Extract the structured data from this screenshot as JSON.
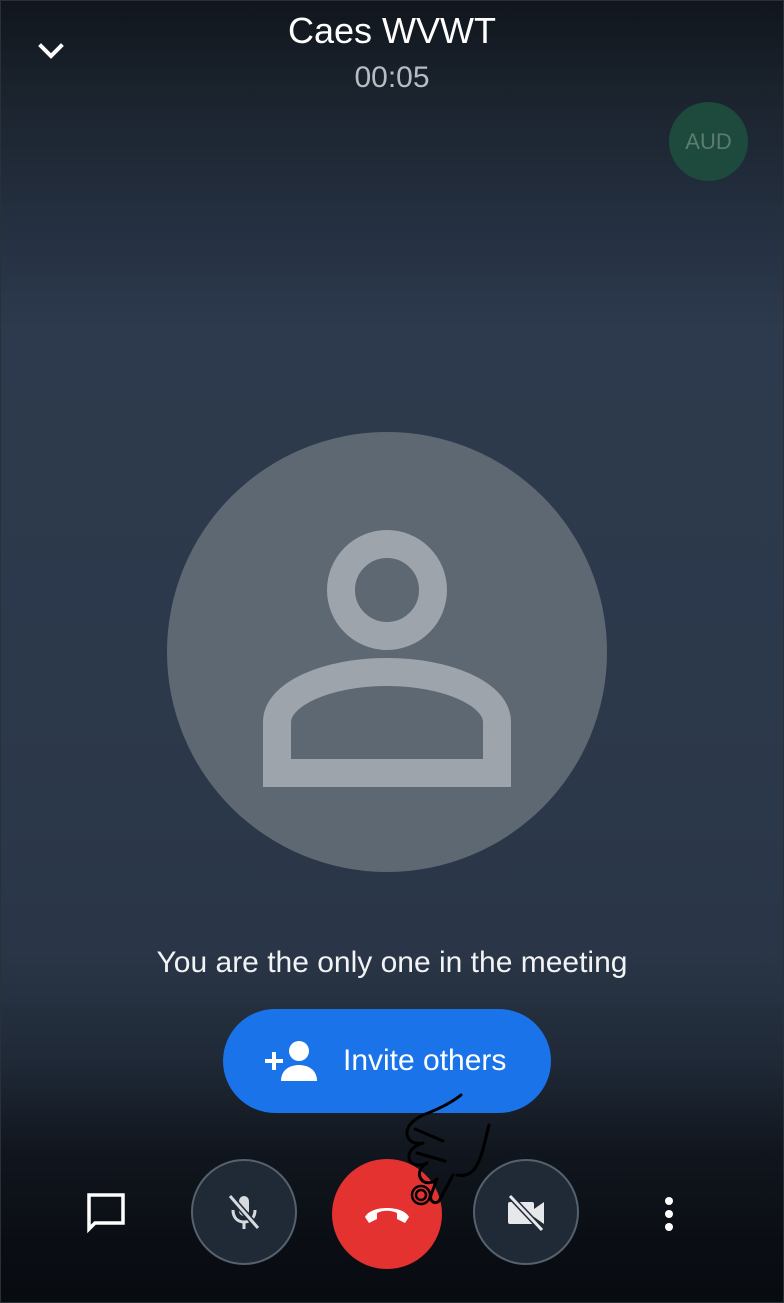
{
  "header": {
    "title": "Caes WVWT",
    "timer": "00:05",
    "collapse_icon": "chevron-down-icon"
  },
  "participant_badge": {
    "label": "AUD",
    "color": "#1d4a3c"
  },
  "main": {
    "avatar_icon": "person-outline-icon",
    "message": "You are the only one in the meeting"
  },
  "invite": {
    "label": "Invite others",
    "icon": "person-add-icon",
    "color": "#1a73e8"
  },
  "controls": {
    "chat_icon": "chat-icon",
    "mic_icon": "mic-off-icon",
    "end_call_icon": "call-end-icon",
    "end_call_color": "#e3322f",
    "camera_icon": "videocam-off-icon",
    "more_icon": "more-vert-icon"
  }
}
